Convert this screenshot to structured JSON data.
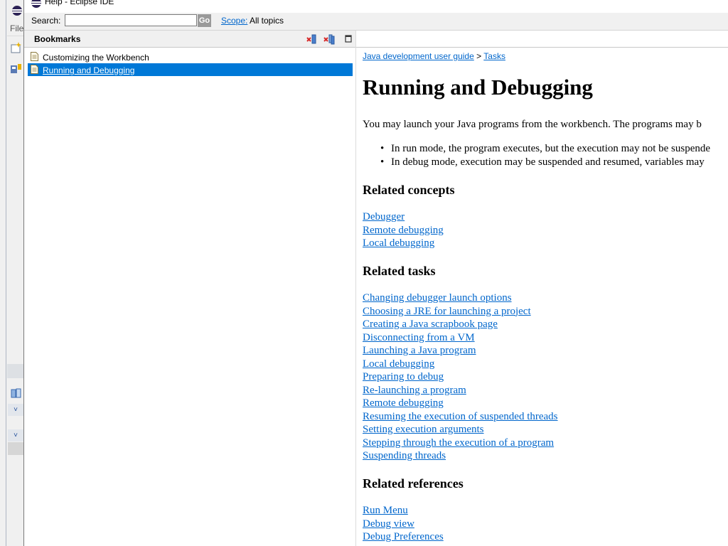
{
  "background_window": {
    "menu_file": "File"
  },
  "window": {
    "title": "Help - Eclipse IDE"
  },
  "search": {
    "label": "Search:",
    "value": "",
    "go_label": "Go",
    "scope_link": "Scope:",
    "scope_value": "All topics"
  },
  "bookmarks": {
    "title": "Bookmarks",
    "items": [
      {
        "label": "Customizing the Workbench",
        "selected": false
      },
      {
        "label": "Running and Debugging",
        "selected": true
      }
    ]
  },
  "content": {
    "breadcrumb": {
      "first": "Java development user guide",
      "separator": ">",
      "second": "Tasks"
    },
    "title": "Running and Debugging",
    "intro": "You may launch your Java programs from the workbench.  The programs may b",
    "bullets": [
      "In run mode, the program executes, but the execution may not be suspende",
      "In debug mode, execution may be suspended and resumed, variables may"
    ],
    "related_concepts": {
      "heading": "Related concepts",
      "links": [
        "Debugger",
        "Remote debugging",
        "Local debugging"
      ]
    },
    "related_tasks": {
      "heading": "Related tasks",
      "links": [
        "Changing debugger launch options",
        "Choosing a JRE for launching a project",
        "Creating a Java scrapbook page",
        "Disconnecting from a VM",
        "Launching a Java program",
        "Local debugging",
        "Preparing to debug",
        "Re-launching a program",
        "Remote debugging",
        "Resuming the execution of suspended threads",
        "Setting execution arguments",
        "Stepping through the execution of a program",
        "Suspending threads"
      ]
    },
    "related_references": {
      "heading": "Related references",
      "links": [
        "Run Menu",
        "Debug view",
        "Debug Preferences"
      ]
    }
  },
  "colors": {
    "link": "#0066cc",
    "selection": "#0078d7",
    "panel_bg": "#f0f0f0"
  },
  "icons": {
    "remove_bookmark": "remove-bookmark-icon",
    "remove_all_bookmarks": "remove-all-bookmarks-icon",
    "minimize": "minimize-icon",
    "document": "document-icon"
  }
}
